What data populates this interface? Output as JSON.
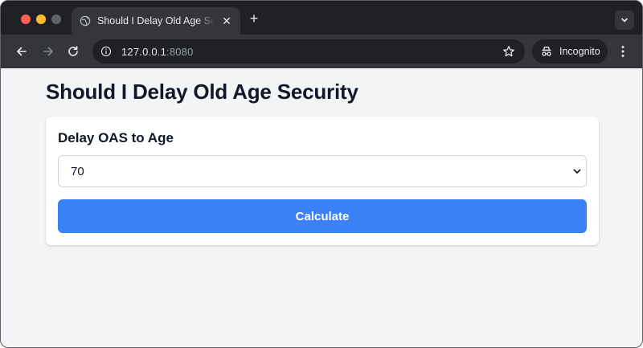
{
  "browser": {
    "tab_title": "Should I Delay Old Age Security",
    "url_host": "127.0.0.1",
    "url_port": ":8080",
    "profile_label": "Incognito",
    "icons": {
      "tab": "globe-icon",
      "back": "back-arrow-icon",
      "forward": "forward-arrow-icon",
      "reload": "reload-icon",
      "site_info": "info-icon",
      "bookmark": "star-icon",
      "profile": "incognito-icon",
      "menu": "kebab-menu-icon"
    },
    "colors": {
      "frame": "#202124",
      "toolbar": "#35363a"
    }
  },
  "page": {
    "title": "Should I Delay Old Age Security",
    "form": {
      "delay_label": "Delay OAS to Age",
      "delay_value": "70",
      "calculate_label": "Calculate"
    },
    "colors": {
      "background": "#f3f4f6",
      "accent": "#3b82f6",
      "text": "#111827"
    }
  }
}
